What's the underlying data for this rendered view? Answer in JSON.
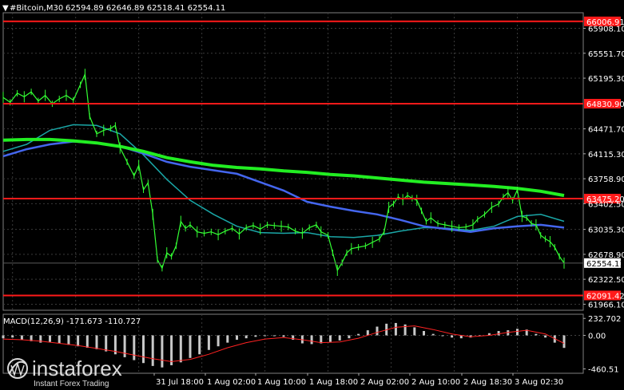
{
  "header": {
    "title": "#Bitcoin,M30",
    "ohlc": "62594.89 62646.89 62518.41 62554.11",
    "macd_label": "MACD(12,26,9) -171.673 -110.727"
  },
  "watermark": {
    "brand": "instaforex",
    "tagline": "Instant Forex Trading"
  },
  "colors": {
    "background": "#000000",
    "price": "#33ff33",
    "ma_fast": "#1aa7a7",
    "ma_mid": "#4466ee",
    "ma_slow": "#22ee22",
    "hline": "#ff1a1a",
    "macd_hist": "#c8c8c8",
    "macd_signal": "#ff2222"
  },
  "chart_data": [
    {
      "type": "line",
      "symbol": "#Bitcoin",
      "timeframe": "M30",
      "y_ticks": [
        "65908.10",
        "65551.70",
        "65195.30",
        "64471.70",
        "64115.30",
        "63758.90",
        "63402.50",
        "63035.30",
        "62678.90",
        "62322.50",
        "61966.10"
      ],
      "ylim": [
        61880,
        66130
      ],
      "x_ticks": [
        "31 Jul 18:00",
        "1 Aug 02:00",
        "1 Aug 10:00",
        "1 Aug 18:00",
        "2 Aug 02:00",
        "2 Aug 10:00",
        "2 Aug 18:30",
        "3 Aug 02:30"
      ],
      "grid": true,
      "price_series": [
        [
          0,
          64920
        ],
        [
          3,
          64850
        ],
        [
          6,
          64980
        ],
        [
          9,
          64930
        ],
        [
          12,
          65000
        ],
        [
          15,
          64870
        ],
        [
          18,
          64950
        ],
        [
          21,
          64830
        ],
        [
          24,
          64900
        ],
        [
          27,
          64950
        ],
        [
          30,
          64880
        ],
        [
          33,
          65100
        ],
        [
          35,
          65250
        ],
        [
          37,
          64650
        ],
        [
          40,
          64400
        ],
        [
          43,
          64450
        ],
        [
          46,
          64480
        ],
        [
          48,
          64520
        ],
        [
          50,
          64200
        ],
        [
          53,
          64000
        ],
        [
          56,
          63800
        ],
        [
          58,
          63950
        ],
        [
          60,
          63600
        ],
        [
          62,
          63700
        ],
        [
          64,
          63250
        ],
        [
          66,
          62600
        ],
        [
          68,
          62480
        ],
        [
          70,
          62700
        ],
        [
          72,
          62650
        ],
        [
          74,
          62800
        ],
        [
          76,
          63150
        ],
        [
          78,
          63050
        ],
        [
          80,
          63100
        ],
        [
          83,
          63000
        ],
        [
          86,
          62980
        ],
        [
          89,
          63000
        ],
        [
          92,
          62960
        ],
        [
          95,
          63010
        ],
        [
          98,
          63050
        ],
        [
          101,
          62970
        ],
        [
          104,
          63060
        ],
        [
          107,
          63090
        ],
        [
          110,
          63040
        ],
        [
          113,
          63100
        ],
        [
          116,
          63090
        ],
        [
          119,
          63080
        ],
        [
          122,
          63070
        ],
        [
          125,
          63010
        ],
        [
          128,
          62980
        ],
        [
          131,
          63060
        ],
        [
          134,
          63100
        ],
        [
          136,
          63000
        ],
        [
          139,
          62950
        ],
        [
          141,
          62700
        ],
        [
          143,
          62450
        ],
        [
          145,
          62560
        ],
        [
          147,
          62700
        ],
        [
          149,
          62760
        ],
        [
          152,
          62780
        ],
        [
          155,
          62800
        ],
        [
          158,
          62850
        ],
        [
          161,
          62900
        ],
        [
          163,
          63000
        ],
        [
          165,
          63350
        ],
        [
          167,
          63400
        ],
        [
          169,
          63500
        ],
        [
          171,
          63460
        ],
        [
          173,
          63520
        ],
        [
          175,
          63480
        ],
        [
          177,
          63450
        ],
        [
          179,
          63300
        ],
        [
          181,
          63150
        ],
        [
          183,
          63200
        ],
        [
          186,
          63120
        ],
        [
          189,
          63100
        ],
        [
          192,
          63080
        ],
        [
          195,
          63060
        ],
        [
          198,
          63070
        ],
        [
          201,
          63100
        ],
        [
          203,
          63180
        ],
        [
          206,
          63250
        ],
        [
          209,
          63350
        ],
        [
          212,
          63400
        ],
        [
          214,
          63500
        ],
        [
          216,
          63560
        ],
        [
          218,
          63450
        ],
        [
          220,
          63600
        ],
        [
          222,
          63220
        ],
        [
          224,
          63200
        ],
        [
          226,
          63120
        ],
        [
          228,
          63100
        ],
        [
          230,
          62950
        ],
        [
          232,
          62900
        ],
        [
          234,
          62860
        ],
        [
          236,
          62780
        ],
        [
          238,
          62650
        ],
        [
          240,
          62554
        ]
      ],
      "ma_fast": [
        [
          0,
          64150
        ],
        [
          10,
          64250
        ],
        [
          20,
          64450
        ],
        [
          30,
          64530
        ],
        [
          40,
          64520
        ],
        [
          50,
          64400
        ],
        [
          60,
          64100
        ],
        [
          70,
          63750
        ],
        [
          80,
          63450
        ],
        [
          90,
          63250
        ],
        [
          100,
          63080
        ],
        [
          110,
          62990
        ],
        [
          120,
          62980
        ],
        [
          130,
          62990
        ],
        [
          140,
          62930
        ],
        [
          150,
          62920
        ],
        [
          160,
          62950
        ],
        [
          170,
          63010
        ],
        [
          180,
          63060
        ],
        [
          190,
          63050
        ],
        [
          200,
          63020
        ],
        [
          210,
          63080
        ],
        [
          220,
          63220
        ],
        [
          230,
          63250
        ],
        [
          240,
          63150
        ]
      ],
      "ma_mid": [
        [
          0,
          64080
        ],
        [
          10,
          64180
        ],
        [
          20,
          64250
        ],
        [
          30,
          64290
        ],
        [
          40,
          64270
        ],
        [
          50,
          64220
        ],
        [
          60,
          64120
        ],
        [
          70,
          64000
        ],
        [
          80,
          63930
        ],
        [
          90,
          63880
        ],
        [
          100,
          63830
        ],
        [
          110,
          63710
        ],
        [
          120,
          63590
        ],
        [
          130,
          63430
        ],
        [
          140,
          63360
        ],
        [
          150,
          63300
        ],
        [
          160,
          63250
        ],
        [
          170,
          63170
        ],
        [
          180,
          63080
        ],
        [
          190,
          63040
        ],
        [
          200,
          63000
        ],
        [
          210,
          63050
        ],
        [
          220,
          63080
        ],
        [
          230,
          63100
        ],
        [
          240,
          63060
        ]
      ],
      "ma_slow": [
        [
          0,
          64310
        ],
        [
          10,
          64320
        ],
        [
          20,
          64320
        ],
        [
          30,
          64300
        ],
        [
          40,
          64270
        ],
        [
          50,
          64220
        ],
        [
          60,
          64150
        ],
        [
          70,
          64060
        ],
        [
          80,
          64000
        ],
        [
          90,
          63950
        ],
        [
          100,
          63920
        ],
        [
          110,
          63900
        ],
        [
          120,
          63870
        ],
        [
          130,
          63850
        ],
        [
          140,
          63820
        ],
        [
          150,
          63800
        ],
        [
          160,
          63770
        ],
        [
          170,
          63740
        ],
        [
          180,
          63710
        ],
        [
          190,
          63690
        ],
        [
          200,
          63670
        ],
        [
          210,
          63650
        ],
        [
          220,
          63620
        ],
        [
          230,
          63580
        ],
        [
          240,
          63520
        ]
      ],
      "hlines": [
        {
          "value": 66006.91,
          "label": "66006.91"
        },
        {
          "value": 64830.9,
          "label": "64830.90"
        },
        {
          "value": 63475.2,
          "label": "63475.20"
        },
        {
          "value": 62091.42,
          "label": "62091.42"
        }
      ],
      "current_price": "62554.11"
    },
    {
      "type": "bar",
      "name": "MACD(12,26,9)",
      "y_ticks": [
        "232.702",
        "0.00",
        "-460.51"
      ],
      "ylim": [
        -520,
        290
      ],
      "zero_line": true,
      "histogram": [
        [
          0,
          -40
        ],
        [
          4,
          -30
        ],
        [
          8,
          -60
        ],
        [
          12,
          -80
        ],
        [
          16,
          -100
        ],
        [
          20,
          -90
        ],
        [
          24,
          -110
        ],
        [
          28,
          -130
        ],
        [
          32,
          -150
        ],
        [
          36,
          -170
        ],
        [
          40,
          -190
        ],
        [
          44,
          -220
        ],
        [
          48,
          -260
        ],
        [
          52,
          -300
        ],
        [
          56,
          -340
        ],
        [
          60,
          -380
        ],
        [
          64,
          -420
        ],
        [
          68,
          -440
        ],
        [
          72,
          -410
        ],
        [
          76,
          -370
        ],
        [
          80,
          -310
        ],
        [
          84,
          -260
        ],
        [
          88,
          -200
        ],
        [
          92,
          -150
        ],
        [
          96,
          -100
        ],
        [
          100,
          -60
        ],
        [
          104,
          -40
        ],
        [
          108,
          -20
        ],
        [
          112,
          -10
        ],
        [
          116,
          -10
        ],
        [
          120,
          -20
        ],
        [
          124,
          -60
        ],
        [
          128,
          -110
        ],
        [
          132,
          -120
        ],
        [
          136,
          -110
        ],
        [
          140,
          -90
        ],
        [
          144,
          -70
        ],
        [
          148,
          -40
        ],
        [
          152,
          20
        ],
        [
          156,
          70
        ],
        [
          160,
          120
        ],
        [
          164,
          160
        ],
        [
          168,
          170
        ],
        [
          172,
          150
        ],
        [
          176,
          110
        ],
        [
          180,
          60
        ],
        [
          184,
          20
        ],
        [
          188,
          -10
        ],
        [
          192,
          -30
        ],
        [
          196,
          -40
        ],
        [
          200,
          -30
        ],
        [
          204,
          -10
        ],
        [
          208,
          30
        ],
        [
          212,
          60
        ],
        [
          216,
          70
        ],
        [
          220,
          90
        ],
        [
          224,
          80
        ],
        [
          228,
          20
        ],
        [
          232,
          -30
        ],
        [
          236,
          -100
        ],
        [
          240,
          -172
        ]
      ],
      "signal": [
        [
          0,
          -50
        ],
        [
          8,
          -60
        ],
        [
          16,
          -80
        ],
        [
          24,
          -110
        ],
        [
          32,
          -140
        ],
        [
          40,
          -180
        ],
        [
          48,
          -220
        ],
        [
          56,
          -270
        ],
        [
          64,
          -320
        ],
        [
          72,
          -360
        ],
        [
          80,
          -330
        ],
        [
          88,
          -260
        ],
        [
          96,
          -170
        ],
        [
          104,
          -100
        ],
        [
          112,
          -50
        ],
        [
          120,
          -30
        ],
        [
          128,
          -60
        ],
        [
          136,
          -100
        ],
        [
          144,
          -90
        ],
        [
          152,
          -40
        ],
        [
          160,
          40
        ],
        [
          168,
          110
        ],
        [
          176,
          130
        ],
        [
          184,
          80
        ],
        [
          192,
          20
        ],
        [
          200,
          -20
        ],
        [
          208,
          0
        ],
        [
          216,
          40
        ],
        [
          224,
          70
        ],
        [
          232,
          20
        ],
        [
          240,
          -111
        ]
      ]
    }
  ]
}
